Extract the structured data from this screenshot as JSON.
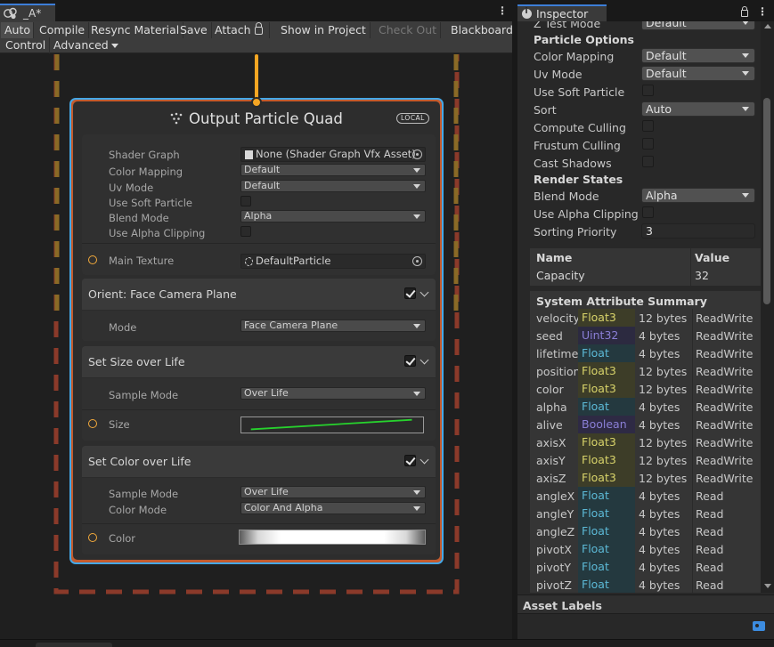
{
  "graph": {
    "tab_title": "_A*",
    "toolbar": {
      "auto": "Auto",
      "compile": "Compile",
      "resync": "Resync Material",
      "save": "Save",
      "attach": "Attach",
      "show_in_project": "Show in Project",
      "check_out": "Check Out",
      "blackboard": "Blackboard",
      "control": "Control",
      "advanced": "Advanced"
    },
    "node": {
      "title": "Output Particle Quad",
      "badge": "LOCAL",
      "settings": {
        "rows": [
          {
            "label": "Shader Graph",
            "value": "None (Shader Graph Vfx Asset)"
          },
          {
            "label": "Color Mapping",
            "value": "Default"
          },
          {
            "label": "Uv Mode",
            "value": "Default"
          },
          {
            "label": "Use Soft Particle",
            "value": ""
          },
          {
            "label": "Blend Mode",
            "value": "Alpha"
          },
          {
            "label": "Use Alpha Clipping",
            "value": ""
          }
        ],
        "main_texture_label": "Main Texture",
        "main_texture_value": "DefaultParticle"
      },
      "blocks": {
        "orient": {
          "title": "Orient: Face Camera Plane",
          "mode_label": "Mode",
          "mode_value": "Face Camera Plane"
        },
        "size": {
          "title": "Set Size over Life",
          "sample_label": "Sample Mode",
          "sample_value": "Over Life",
          "slot_label": "Size"
        },
        "color": {
          "title": "Set Color over Life",
          "sample_label": "Sample Mode",
          "sample_value": "Over Life",
          "mode_label": "Color Mode",
          "mode_value": "Color And Alpha",
          "slot_label": "Color"
        }
      }
    }
  },
  "inspector": {
    "tab_title": "Inspector",
    "top_partial": {
      "label": "Z Test Mode",
      "value": "Default"
    },
    "particle_options": {
      "header": "Particle Options",
      "rows": [
        {
          "label": "Color Mapping",
          "value": "Default",
          "kind": "dropdown"
        },
        {
          "label": "Uv Mode",
          "value": "Default",
          "kind": "dropdown"
        },
        {
          "label": "Use Soft Particle",
          "value": "",
          "kind": "check"
        },
        {
          "label": "Sort",
          "value": "Auto",
          "kind": "dropdown"
        },
        {
          "label": "Compute Culling",
          "value": "",
          "kind": "check"
        },
        {
          "label": "Frustum Culling",
          "value": "",
          "kind": "check"
        },
        {
          "label": "Cast Shadows",
          "value": "",
          "kind": "check"
        }
      ]
    },
    "render_states": {
      "header": "Render States",
      "rows": [
        {
          "label": "Blend Mode",
          "value": "Alpha",
          "kind": "dropdown"
        },
        {
          "label": "Use Alpha Clipping",
          "value": "",
          "kind": "check"
        },
        {
          "label": "Sorting Priority",
          "value": "3",
          "kind": "text"
        }
      ]
    },
    "capacity_table": {
      "col_name": "Name",
      "col_value": "Value",
      "name": "Capacity",
      "value": "32"
    },
    "system_attributes": {
      "title": "System Attribute Summary",
      "rows": [
        {
          "name": "velocity",
          "type": "Float3",
          "size": "12 bytes",
          "access": "ReadWrite"
        },
        {
          "name": "seed",
          "type": "Uint32",
          "size": "4 bytes",
          "access": "ReadWrite"
        },
        {
          "name": "lifetime",
          "type": "Float",
          "size": "4 bytes",
          "access": "ReadWrite"
        },
        {
          "name": "position",
          "type": "Float3",
          "size": "12 bytes",
          "access": "ReadWrite"
        },
        {
          "name": "color",
          "type": "Float3",
          "size": "12 bytes",
          "access": "ReadWrite"
        },
        {
          "name": "alpha",
          "type": "Float",
          "size": "4 bytes",
          "access": "ReadWrite"
        },
        {
          "name": "alive",
          "type": "Boolean",
          "size": "4 bytes",
          "access": "ReadWrite"
        },
        {
          "name": "axisX",
          "type": "Float3",
          "size": "12 bytes",
          "access": "ReadWrite"
        },
        {
          "name": "axisY",
          "type": "Float3",
          "size": "12 bytes",
          "access": "ReadWrite"
        },
        {
          "name": "axisZ",
          "type": "Float3",
          "size": "12 bytes",
          "access": "ReadWrite"
        },
        {
          "name": "angleX",
          "type": "Float",
          "size": "4 bytes",
          "access": "Read"
        },
        {
          "name": "angleY",
          "type": "Float",
          "size": "4 bytes",
          "access": "Read"
        },
        {
          "name": "angleZ",
          "type": "Float",
          "size": "4 bytes",
          "access": "Read"
        },
        {
          "name": "pivotX",
          "type": "Float",
          "size": "4 bytes",
          "access": "Read"
        },
        {
          "name": "pivotY",
          "type": "Float",
          "size": "4 bytes",
          "access": "Read"
        },
        {
          "name": "pivotZ",
          "type": "Float",
          "size": "4 bytes",
          "access": "Read"
        }
      ]
    },
    "asset_labels": "Asset Labels"
  },
  "colors": {
    "type_float3_bg": "#3d3d28",
    "type_float3_fg": "#d8d36a",
    "type_float_bg": "#24393f",
    "type_float_fg": "#5cb9d6",
    "type_uint_bg": "#2c2a40",
    "type_uint_fg": "#8a7fd6",
    "type_bool_bg": "#2e2a44",
    "type_bool_fg": "#8a7fd6",
    "accent_blue": "#44a8e8",
    "flow_orange": "#f6a623",
    "system_border": "#8b3a2a"
  }
}
